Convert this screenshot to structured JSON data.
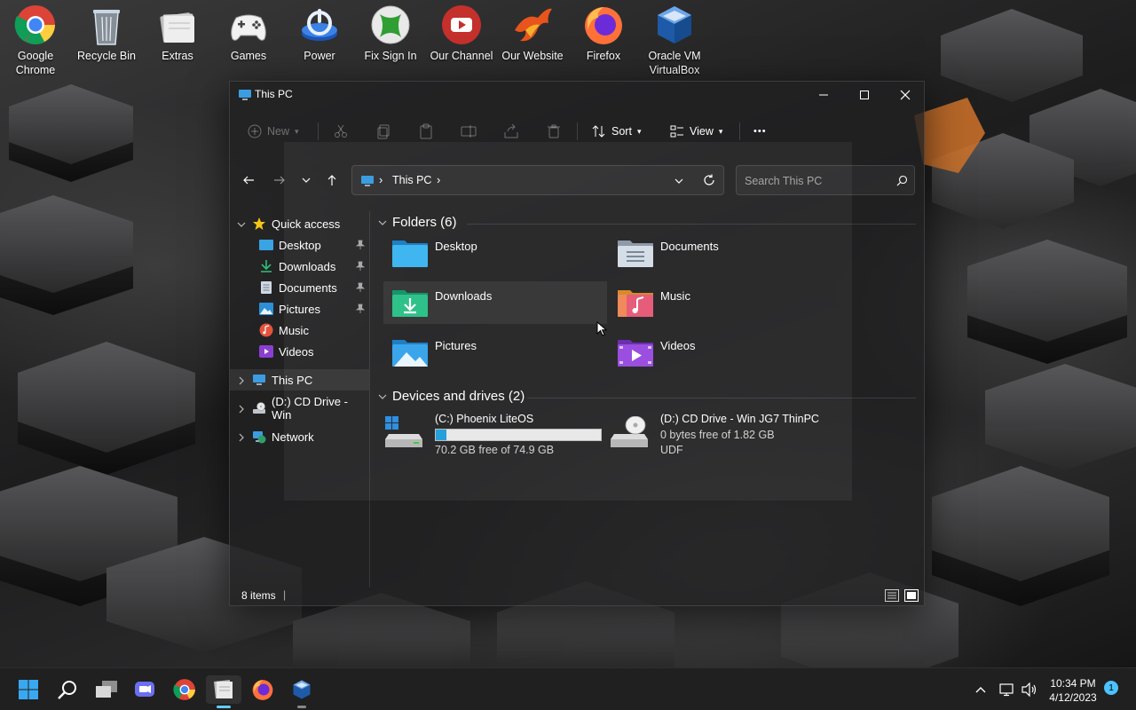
{
  "desktop": {
    "icons": [
      {
        "label": "Google Chrome",
        "icon": "chrome-icon"
      },
      {
        "label": "Recycle Bin",
        "icon": "recycle-bin-icon"
      },
      {
        "label": "Extras",
        "icon": "folder-stack-icon"
      },
      {
        "label": "Games",
        "icon": "gamepad-icon"
      },
      {
        "label": "Power",
        "icon": "power-icon"
      },
      {
        "label": "Fix Sign In",
        "icon": "xbox-icon"
      },
      {
        "label": "Our Channel",
        "icon": "youtube-icon"
      },
      {
        "label": "Our Website",
        "icon": "phoenix-icon"
      },
      {
        "label": "Firefox",
        "icon": "firefox-icon"
      },
      {
        "label": "Oracle VM VirtualBox",
        "icon": "virtualbox-icon"
      }
    ]
  },
  "window": {
    "title": "This PC",
    "toolbar": {
      "new_label": "New",
      "sort_label": "Sort",
      "view_label": "View",
      "more_label": "•••"
    },
    "address": {
      "path": "This PC",
      "separator": "›"
    },
    "search": {
      "placeholder": "Search This PC"
    },
    "nav": {
      "quick_access": "Quick access",
      "items": [
        {
          "label": "Desktop",
          "pinned": true
        },
        {
          "label": "Downloads",
          "pinned": true
        },
        {
          "label": "Documents",
          "pinned": true
        },
        {
          "label": "Pictures",
          "pinned": true
        },
        {
          "label": "Music",
          "pinned": false
        },
        {
          "label": "Videos",
          "pinned": false
        }
      ],
      "this_pc": "This PC",
      "cd_drive": "(D:) CD Drive - Win",
      "network": "Network"
    },
    "folders": {
      "header": "Folders (6)",
      "items": [
        {
          "label": "Desktop"
        },
        {
          "label": "Documents"
        },
        {
          "label": "Downloads"
        },
        {
          "label": "Music"
        },
        {
          "label": "Pictures"
        },
        {
          "label": "Videos"
        }
      ]
    },
    "drives": {
      "header": "Devices and drives (2)",
      "items": [
        {
          "name": "(C:) Phoenix LiteOS",
          "free_text": "70.2 GB free of 74.9 GB",
          "used_fraction": 0.063
        },
        {
          "name": "(D:) CD Drive - Win JG7 ThinPC",
          "free_text": "0 bytes free of 1.82 GB",
          "fs": "UDF"
        }
      ]
    },
    "status": {
      "items_count": "8 items",
      "separator": "|"
    }
  },
  "taskbar": {
    "clock_time": "10:34 PM",
    "clock_date": "4/12/2023",
    "notification_count": "1"
  },
  "colors": {
    "accent": "#60cdff",
    "drive_bar": "#26a0da",
    "quick_access_star": "#f5c518"
  }
}
